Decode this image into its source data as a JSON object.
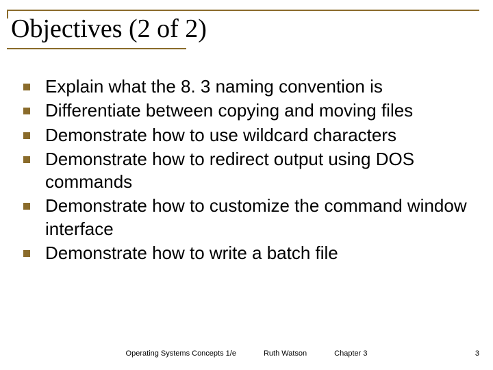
{
  "title": "Objectives (2 of 2)",
  "bullets": [
    "Explain what the 8. 3 naming convention is",
    "Differentiate between copying and moving files",
    "Demonstrate how to use wildcard characters",
    "Demonstrate how to redirect output using DOS commands",
    "Demonstrate how to customize the command window interface",
    "Demonstrate how to write a batch file"
  ],
  "footer": {
    "book": "Operating Systems Concepts 1/e",
    "author": "Ruth Watson",
    "chapter": "Chapter 3"
  },
  "page_number": "3",
  "colors": {
    "accent": "#8a6b2b"
  }
}
